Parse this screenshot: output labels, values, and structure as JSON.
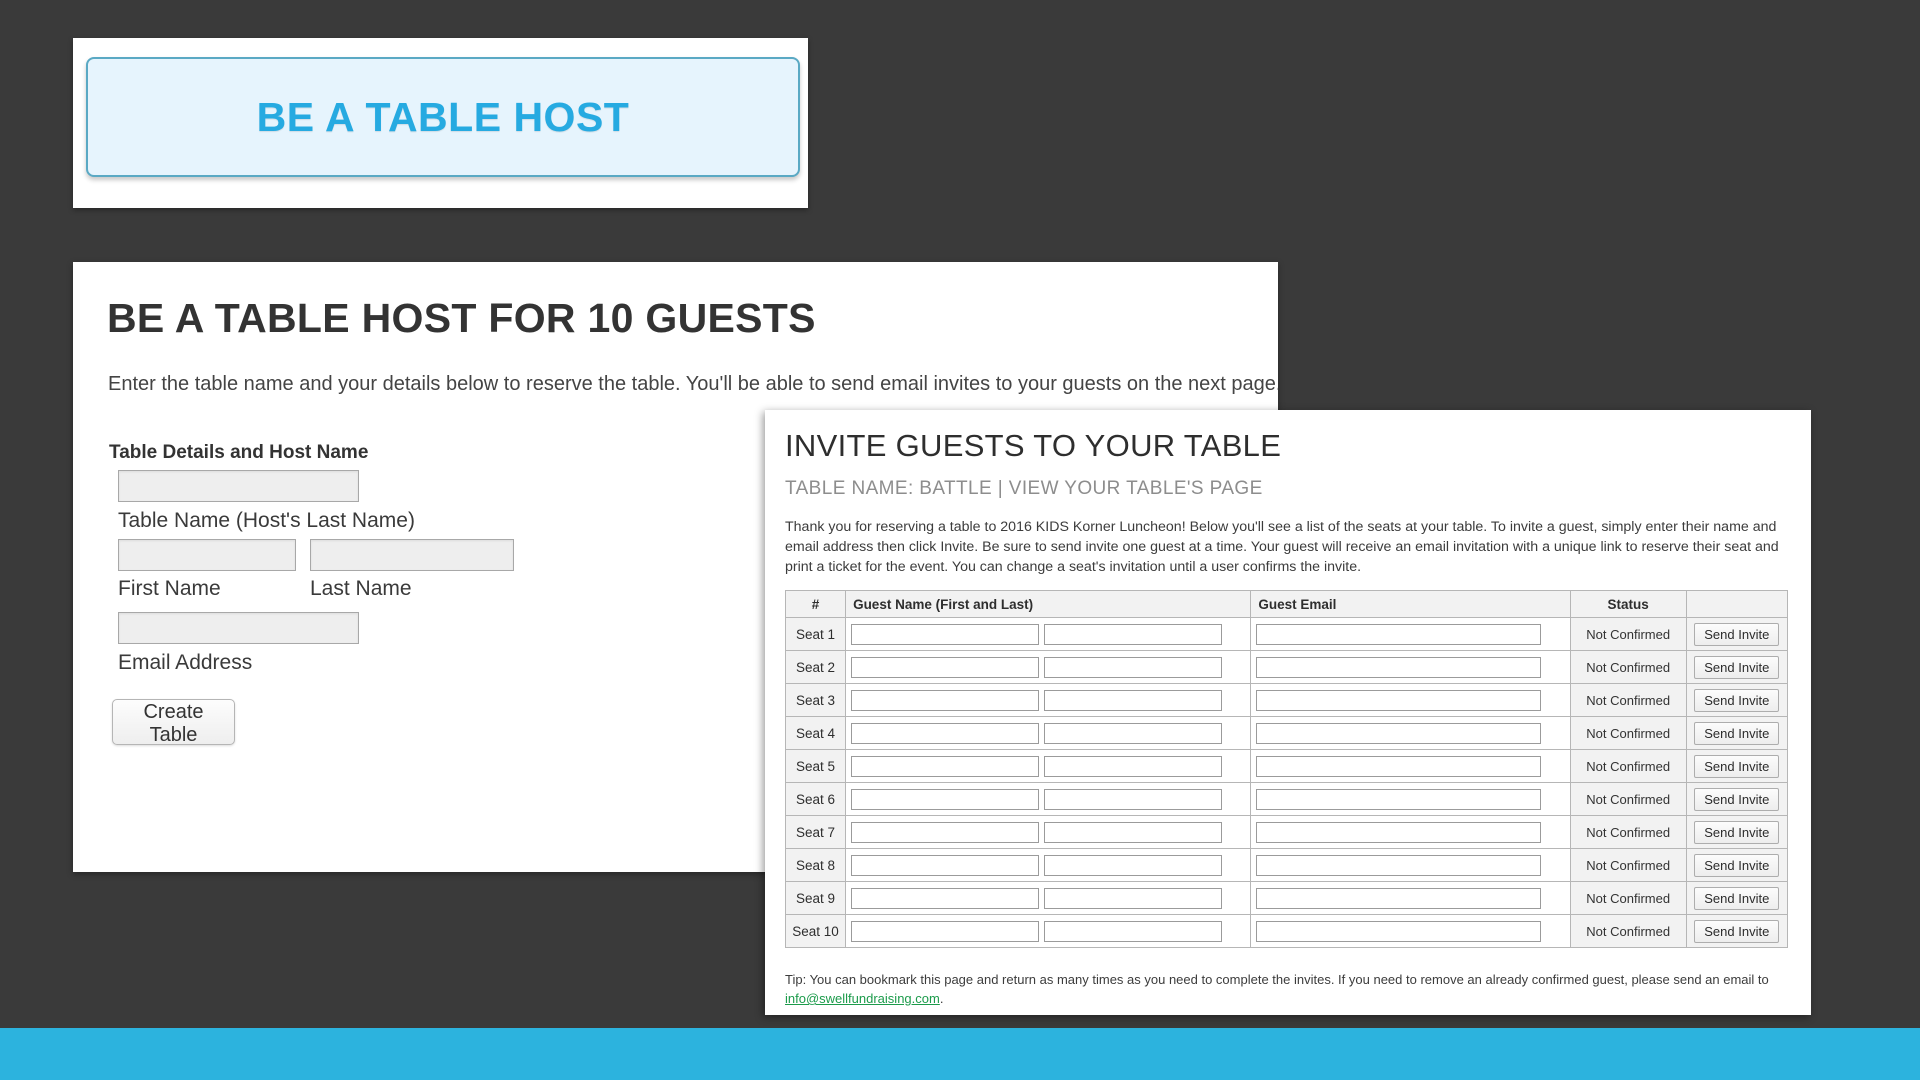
{
  "button_shot": {
    "label": "BE A TABLE HOST",
    "accent_color": "#26aae1",
    "fill_color": "#e6f4fd",
    "border_color": "#5aa9c4"
  },
  "host_form": {
    "title": "BE A TABLE HOST FOR 10 GUESTS",
    "intro": "Enter the table name and your details below to reserve the table. You'll be able to send email invites to your guests on the next page.",
    "section_heading": "Table Details and Host Name",
    "fields": [
      {
        "name": "table_name",
        "label": "Table Name (Host's Last Name)",
        "value": "",
        "placeholder": ""
      },
      {
        "name": "first_name",
        "label": "First Name",
        "value": "",
        "placeholder": ""
      },
      {
        "name": "last_name",
        "label": "Last Name",
        "value": "",
        "placeholder": ""
      },
      {
        "name": "email",
        "label": "Email Address",
        "value": "",
        "placeholder": ""
      }
    ],
    "submit_label": "Create Table"
  },
  "invite_panel": {
    "title": "INVITE GUESTS TO YOUR TABLE",
    "subtitle": "TABLE NAME: BATTLE | VIEW YOUR TABLE'S PAGE",
    "table_name": "BATTLE",
    "view_page_link": "VIEW YOUR TABLE'S PAGE",
    "paragraph": "Thank you for reserving a table to 2016 KIDS Korner Luncheon! Below you'll see a list of the seats at your table. To invite a guest, simply enter their name and email address then click Invite. Be sure to send invite one guest at a time. Your guest will receive an email invitation with a unique link to reserve their seat and print a ticket for the event. You can change a seat's invitation until a user confirms the invite.",
    "columns": {
      "number": "#",
      "guest_name": "Guest Name (First and Last)",
      "guest_email": "Guest Email",
      "status": "Status",
      "action": ""
    },
    "rows": [
      {
        "seat": "Seat 1",
        "first_name": "",
        "last_name": "",
        "email": "",
        "status": "Not Confirmed",
        "action": "Send Invite"
      },
      {
        "seat": "Seat 2",
        "first_name": "",
        "last_name": "",
        "email": "",
        "status": "Not Confirmed",
        "action": "Send Invite"
      },
      {
        "seat": "Seat 3",
        "first_name": "",
        "last_name": "",
        "email": "",
        "status": "Not Confirmed",
        "action": "Send Invite"
      },
      {
        "seat": "Seat 4",
        "first_name": "",
        "last_name": "",
        "email": "",
        "status": "Not Confirmed",
        "action": "Send Invite"
      },
      {
        "seat": "Seat 5",
        "first_name": "",
        "last_name": "",
        "email": "",
        "status": "Not Confirmed",
        "action": "Send Invite"
      },
      {
        "seat": "Seat 6",
        "first_name": "",
        "last_name": "",
        "email": "",
        "status": "Not Confirmed",
        "action": "Send Invite"
      },
      {
        "seat": "Seat 7",
        "first_name": "",
        "last_name": "",
        "email": "",
        "status": "Not Confirmed",
        "action": "Send Invite"
      },
      {
        "seat": "Seat 8",
        "first_name": "",
        "last_name": "",
        "email": "",
        "status": "Not Confirmed",
        "action": "Send Invite"
      },
      {
        "seat": "Seat 9",
        "first_name": "",
        "last_name": "",
        "email": "",
        "status": "Not Confirmed",
        "action": "Send Invite"
      },
      {
        "seat": "Seat 10",
        "first_name": "",
        "last_name": "",
        "email": "",
        "status": "Not Confirmed",
        "action": "Send Invite"
      }
    ],
    "tip_prefix": "Tip: You can bookmark this page and return as many times as you need to complete the invites. If you need to remove an already confirmed guest, please send an email to ",
    "tip_email": "info@swellfundraising.com",
    "tip_suffix": "."
  },
  "theme": {
    "background": "#3a3a3a",
    "strip_color": "#2cb3de",
    "link_color": "#1c9b4b"
  }
}
